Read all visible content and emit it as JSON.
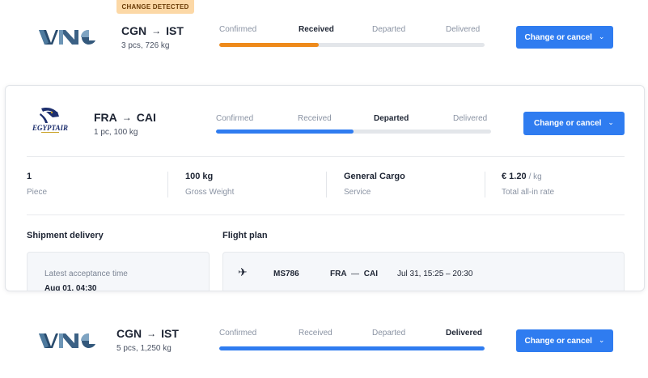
{
  "colors": {
    "accent": "#2f7cf0",
    "progress_orange": "#ee8a1b",
    "progress_blue": "#2f7cf0",
    "badge_bg": "#fcd8a6"
  },
  "stage_labels": [
    "Confirmed",
    "Received",
    "Departed",
    "Delivered"
  ],
  "shipments": [
    {
      "badge": "CHANGE DETECTED",
      "logo": "vnc-logo",
      "origin": "CGN",
      "destination": "IST",
      "summary": "3 pcs, 726 kg",
      "active_stage": "Received",
      "progress": 0.375,
      "action_label": "Change or cancel"
    },
    {
      "logo": "egyptair-cargo-logo",
      "logo_text": "EGYPTAIR",
      "origin": "FRA",
      "destination": "CAI",
      "summary": "1 pc, 100 kg",
      "active_stage": "Departed",
      "progress": 0.5,
      "action_label": "Change or cancel",
      "details": {
        "stats": [
          {
            "value": "1",
            "unit": "",
            "label": "Piece"
          },
          {
            "value": "100 kg",
            "unit": "",
            "label": "Gross Weight"
          },
          {
            "value": "General Cargo",
            "unit": "",
            "label": "Service"
          },
          {
            "value": "€ 1.20",
            "unit": "/ kg",
            "label": "Total all-in rate"
          }
        ],
        "delivery": {
          "title": "Shipment delivery",
          "label": "Latest acceptance time",
          "value": "Aug 01, 04:30"
        },
        "flight_plan": {
          "title": "Flight plan",
          "flights": [
            {
              "number": "MS786",
              "origin": "FRA",
              "destination": "CAI",
              "time": "Jul 31, 15:25 – 20:30"
            }
          ]
        }
      }
    },
    {
      "logo": "vnc-logo",
      "origin": "CGN",
      "destination": "IST",
      "summary": "5 pcs, 1,250 kg",
      "active_stage": "Delivered",
      "progress": 1.0,
      "action_label": "Change or cancel"
    }
  ]
}
